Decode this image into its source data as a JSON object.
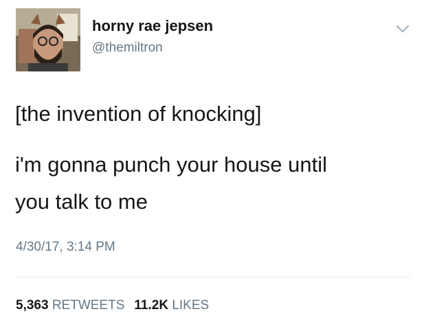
{
  "tweet": {
    "display_name": "horny rae jepsen",
    "handle": "@themiltron",
    "text_lines": [
      "[the invention of knocking]",
      "i'm gonna punch your house until",
      "you talk to me"
    ],
    "timestamp": "4/30/17, 3:14 PM",
    "stats": {
      "retweets_count": "5,363",
      "retweets_label": "RETWEETS",
      "likes_count": "11.2K",
      "likes_label": "LIKES"
    }
  },
  "icons": {
    "menu": "chevron-down-icon"
  },
  "colors": {
    "primary_text": "#14171a",
    "secondary_text": "#657786",
    "divider": "#e1e8ed",
    "background": "#ffffff"
  }
}
